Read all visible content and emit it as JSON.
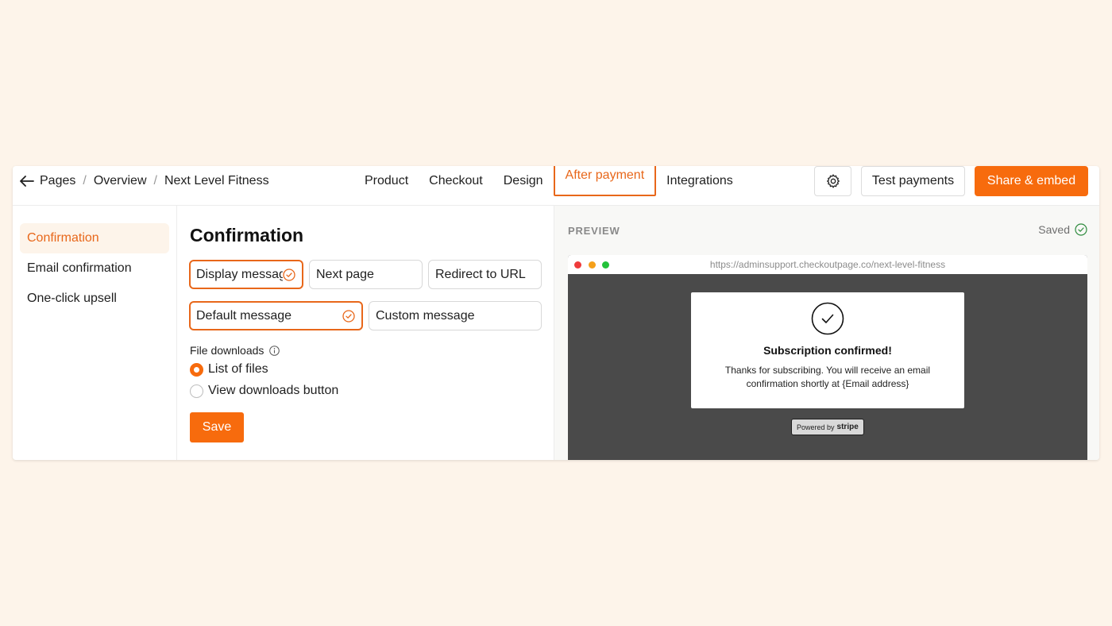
{
  "breadcrumb": {
    "back_icon": "arrow-left-icon",
    "items": [
      "Pages",
      "Overview",
      "Next Level Fitness"
    ],
    "separator": "/"
  },
  "tabs": [
    {
      "label": "Product",
      "active": false
    },
    {
      "label": "Checkout",
      "active": false
    },
    {
      "label": "Design",
      "active": false
    },
    {
      "label": "After payment",
      "active": true
    },
    {
      "label": "Integrations",
      "active": false
    }
  ],
  "toolbar": {
    "settings_icon": "gear-icon",
    "test_label": "Test payments",
    "share_label": "Share & embed"
  },
  "sidebar": {
    "items": [
      {
        "label": "Confirmation",
        "active": true
      },
      {
        "label": "Email confirmation",
        "active": false
      },
      {
        "label": "One-click upsell",
        "active": false
      }
    ]
  },
  "main": {
    "title": "Confirmation",
    "action_options": [
      {
        "label": "Display message",
        "selected": true
      },
      {
        "label": "Next page",
        "selected": false
      },
      {
        "label": "Redirect to URL",
        "selected": false
      }
    ],
    "message_options": [
      {
        "label": "Default message",
        "selected": true
      },
      {
        "label": "Custom message",
        "selected": false
      }
    ],
    "file_downloads_label": "File downloads",
    "file_download_options": [
      {
        "label": "List of files",
        "checked": true
      },
      {
        "label": "View downloads button",
        "checked": false
      }
    ],
    "save_label": "Save"
  },
  "preview": {
    "label": "PREVIEW",
    "saved_label": "Saved",
    "url": "https://adminsupport.checkoutpage.co/next-level-fitness",
    "card_title": "Subscription confirmed!",
    "card_body": "Thanks for subscribing. You will receive an email confirmation shortly at {Email address}",
    "powered_by": "Powered by",
    "powered_brand": "stripe"
  },
  "colors": {
    "accent": "#f76b0d",
    "accent_text": "#e8671a",
    "background": "#fdf4ea",
    "preview_dark": "#4a4a4a"
  }
}
